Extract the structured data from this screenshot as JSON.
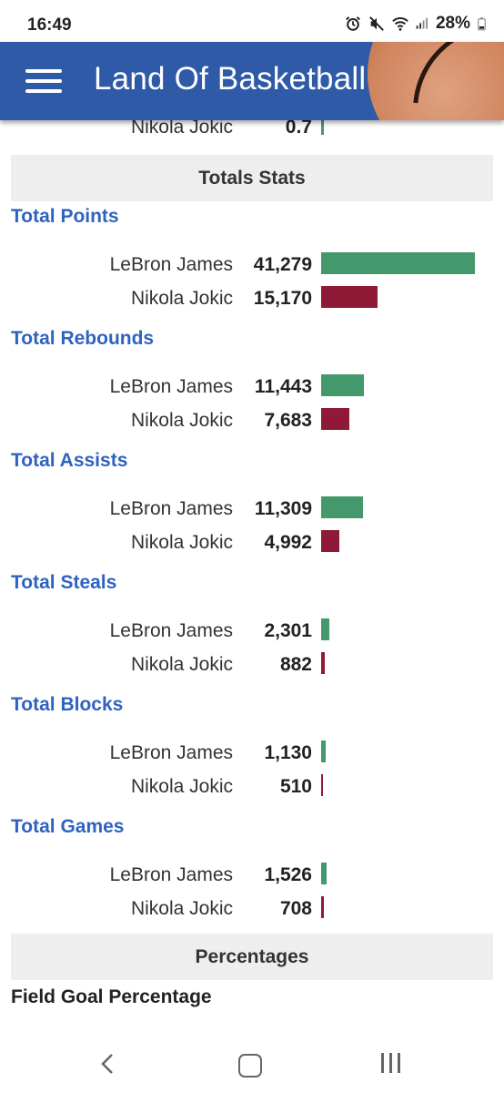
{
  "status": {
    "time": "16:49",
    "battery": "28%"
  },
  "header": {
    "title": "Land Of Basketball"
  },
  "partial_row": {
    "name": "Nikola Jokic",
    "value": "0.7",
    "fraction": 0.01
  },
  "sections": {
    "totals": "Totals Stats",
    "percentages": "Percentages"
  },
  "stats": [
    {
      "title": "Total Points",
      "rows": [
        {
          "name": "LeBron James",
          "value": "41,279",
          "fraction": 1.0,
          "color": "green"
        },
        {
          "name": "Nikola Jokic",
          "value": "15,170",
          "fraction": 0.3675,
          "color": "red"
        }
      ]
    },
    {
      "title": "Total Rebounds",
      "rows": [
        {
          "name": "LeBron James",
          "value": "11,443",
          "fraction": 0.2772,
          "color": "green"
        },
        {
          "name": "Nikola Jokic",
          "value": "7,683",
          "fraction": 0.1861,
          "color": "red"
        }
      ]
    },
    {
      "title": "Total Assists",
      "rows": [
        {
          "name": "LeBron James",
          "value": "11,309",
          "fraction": 0.274,
          "color": "green"
        },
        {
          "name": "Nikola Jokic",
          "value": "4,992",
          "fraction": 0.1209,
          "color": "red"
        }
      ]
    },
    {
      "title": "Total Steals",
      "rows": [
        {
          "name": "LeBron James",
          "value": "2,301",
          "fraction": 0.0557,
          "color": "green"
        },
        {
          "name": "Nikola Jokic",
          "value": "882",
          "fraction": 0.0214,
          "color": "red"
        }
      ]
    },
    {
      "title": "Total Blocks",
      "rows": [
        {
          "name": "LeBron James",
          "value": "1,130",
          "fraction": 0.0274,
          "color": "green"
        },
        {
          "name": "Nikola Jokic",
          "value": "510",
          "fraction": 0.0124,
          "color": "red"
        }
      ]
    },
    {
      "title": "Total Games",
      "rows": [
        {
          "name": "LeBron James",
          "value": "1,526",
          "fraction": 0.037,
          "color": "green"
        },
        {
          "name": "Nikola Jokic",
          "value": "708",
          "fraction": 0.0172,
          "color": "red"
        }
      ]
    }
  ],
  "next_title": "Field Goal Percentage",
  "colors": {
    "header": "#2e5aa8",
    "green": "#43996b",
    "red": "#8e1a38",
    "title_blue": "#2f63c0"
  },
  "icons": [
    "alarm-icon",
    "mute-icon",
    "wifi-icon",
    "signal-icon",
    "battery-icon",
    "menu-icon",
    "back-icon",
    "home-icon",
    "recents-icon"
  ]
}
